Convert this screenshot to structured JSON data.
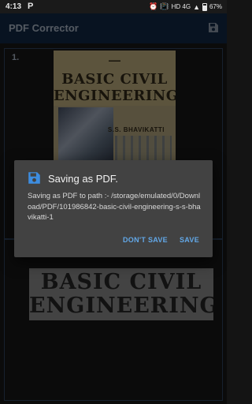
{
  "status_bar": {
    "time": "4:13",
    "app_icon": "P",
    "indicators": "HD 4G",
    "battery": "67%",
    "icons": [
      "alarm-icon",
      "vibrate-icon",
      "signal-icon",
      "battery-icon"
    ]
  },
  "app_bar": {
    "title": "PDF Corrector",
    "save_icon": "save-icon"
  },
  "pages": [
    {
      "number": "1.",
      "cover": {
        "title_line1": "BASIC CIVIL",
        "title_line2": "ENGINEERING",
        "author": "S.S. BHAVIKATTI"
      }
    },
    {
      "scan": {
        "line1": "BASIC CIVIL",
        "line2": "ENGINEERING"
      }
    }
  ],
  "dialog": {
    "title": "Saving as PDF.",
    "message": "Saving as PDF to path :- /storage/emulated/0/Download/PDF/101986842-basic-civil-engineering-s-s-bhavikatti-1",
    "dont_save_label": "DON'T SAVE",
    "save_label": "SAVE"
  },
  "colors": {
    "app_bar": "#10243d",
    "accent": "#62a8e8",
    "dialog_bg": "#424242"
  }
}
